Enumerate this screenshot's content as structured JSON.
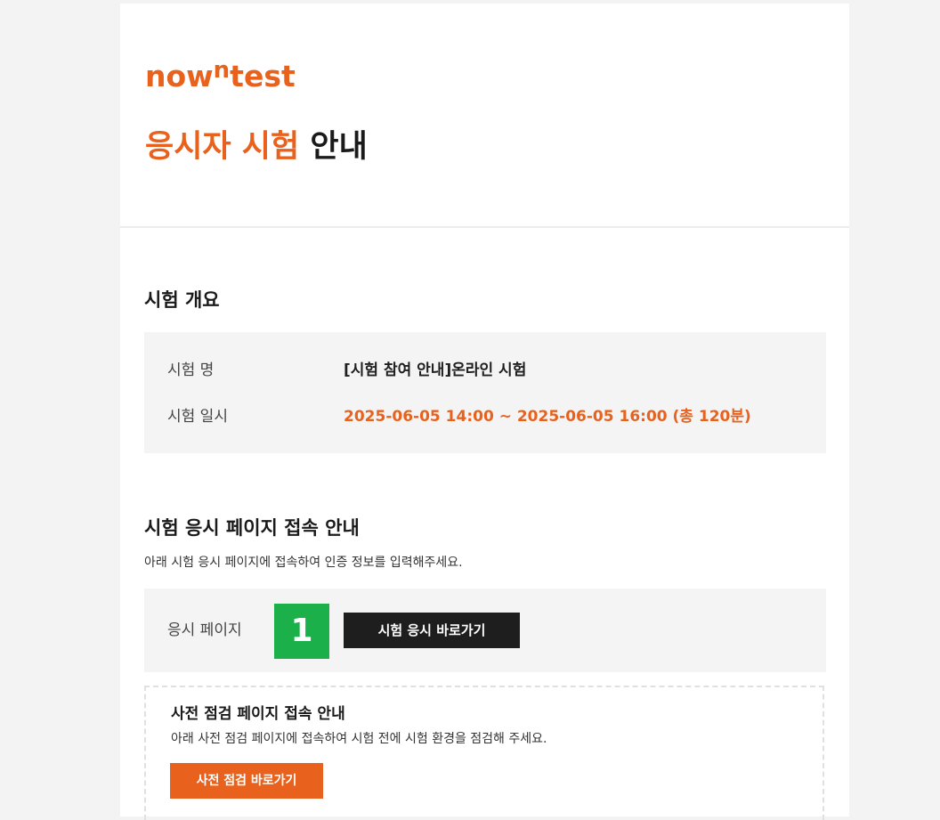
{
  "logo": {
    "prefix": "now",
    "sup": "n",
    "suffix": "test"
  },
  "header": {
    "title_accent": "응시자 시험",
    "title_rest": "안내"
  },
  "overview": {
    "heading": "시험 개요",
    "rows": [
      {
        "label": "시험 명",
        "value": "[시험 참여 안내]온라인 시험"
      },
      {
        "label": "시험 일시",
        "value": "2025-06-05 14:00 ~ 2025-06-05 16:00 (총 120분)"
      }
    ]
  },
  "access": {
    "heading": "시험 응시 페이지 접속 안내",
    "description": "아래 시험 응시 페이지에 접속하여 인증 정보를 입력해주세요.",
    "page_label": "응시 페이지",
    "marker": "1",
    "button_label": "시험 응시 바로가기"
  },
  "precheck": {
    "heading": "사전 점검 페이지 접속 안내",
    "description": "아래 사전 점검 페이지에 접속하여 시험 전에 시험 환경을 점검해 주세요.",
    "button_label": "사전 점검 바로가기"
  },
  "colors": {
    "accent": "#e8621e",
    "dark_button": "#1e1e1e",
    "marker": "#1cb04a",
    "panel": "#f4f4f4"
  }
}
